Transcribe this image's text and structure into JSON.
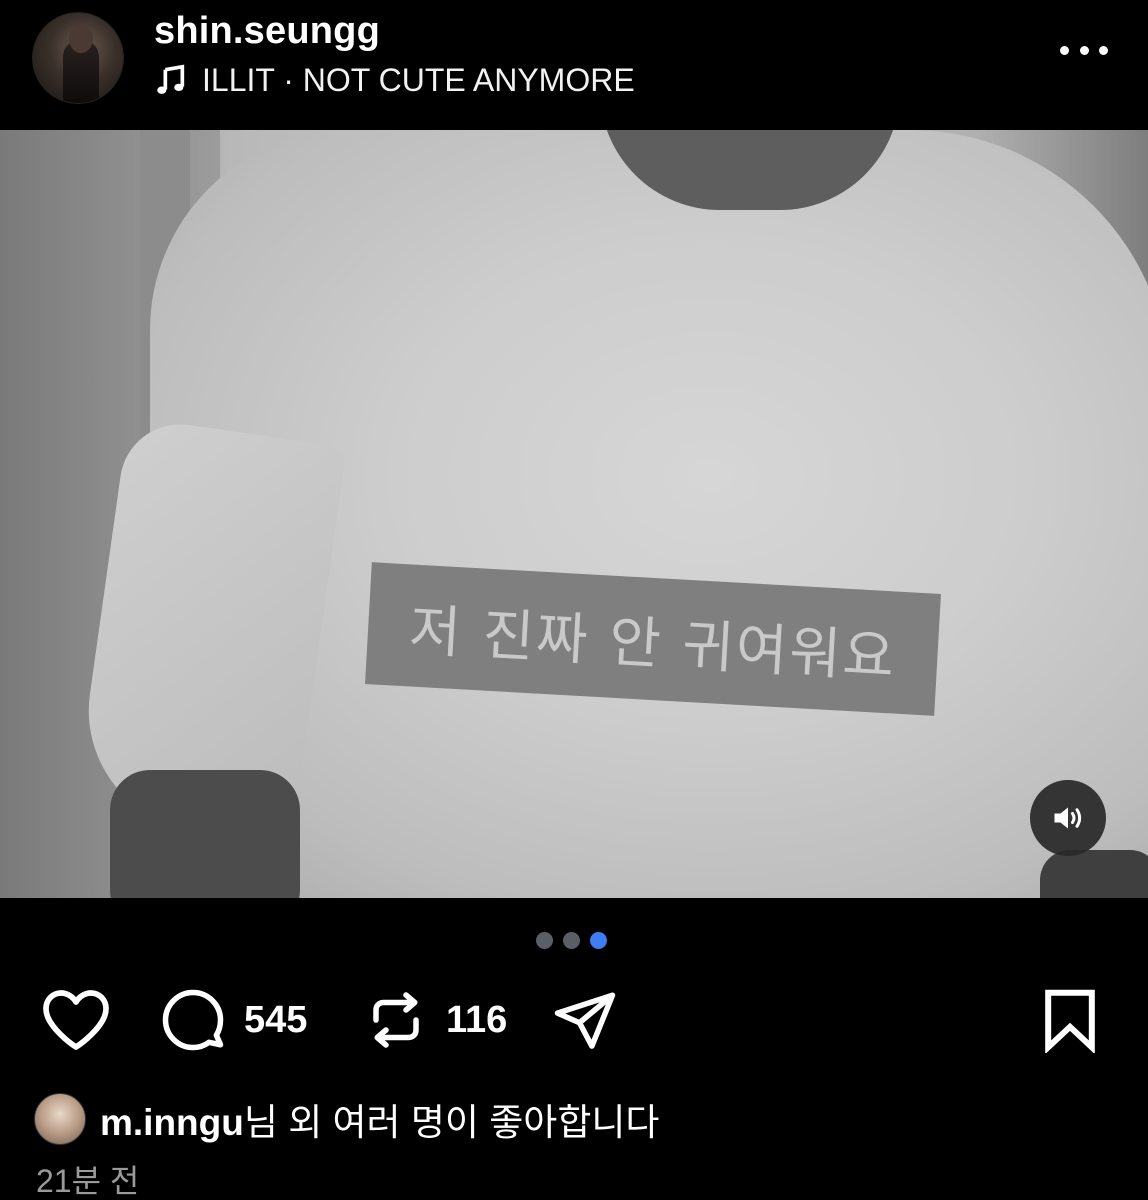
{
  "header": {
    "username": "shin.seungg",
    "music_label": "ILLIT · NOT CUTE ANYMORE",
    "music_icon": "music-note-icon",
    "more_icon": "more-horizontal-icon"
  },
  "media": {
    "shirt_text": "저 진짜 안 귀여워요",
    "sound_icon": "speaker-icon"
  },
  "carousel": {
    "total": 3,
    "active_index": 2,
    "active_color": "#3f7df2",
    "inactive_color": "#5a5f66"
  },
  "actions": {
    "like_icon": "heart-icon",
    "comment_icon": "comment-icon",
    "comment_count": "545",
    "repost_icon": "repost-icon",
    "repost_count": "116",
    "share_icon": "send-icon",
    "save_icon": "bookmark-icon"
  },
  "likes": {
    "username": "m.inngu",
    "suffix": "님 외 여러 명이 좋아합니다"
  },
  "timestamp": "21분 전"
}
